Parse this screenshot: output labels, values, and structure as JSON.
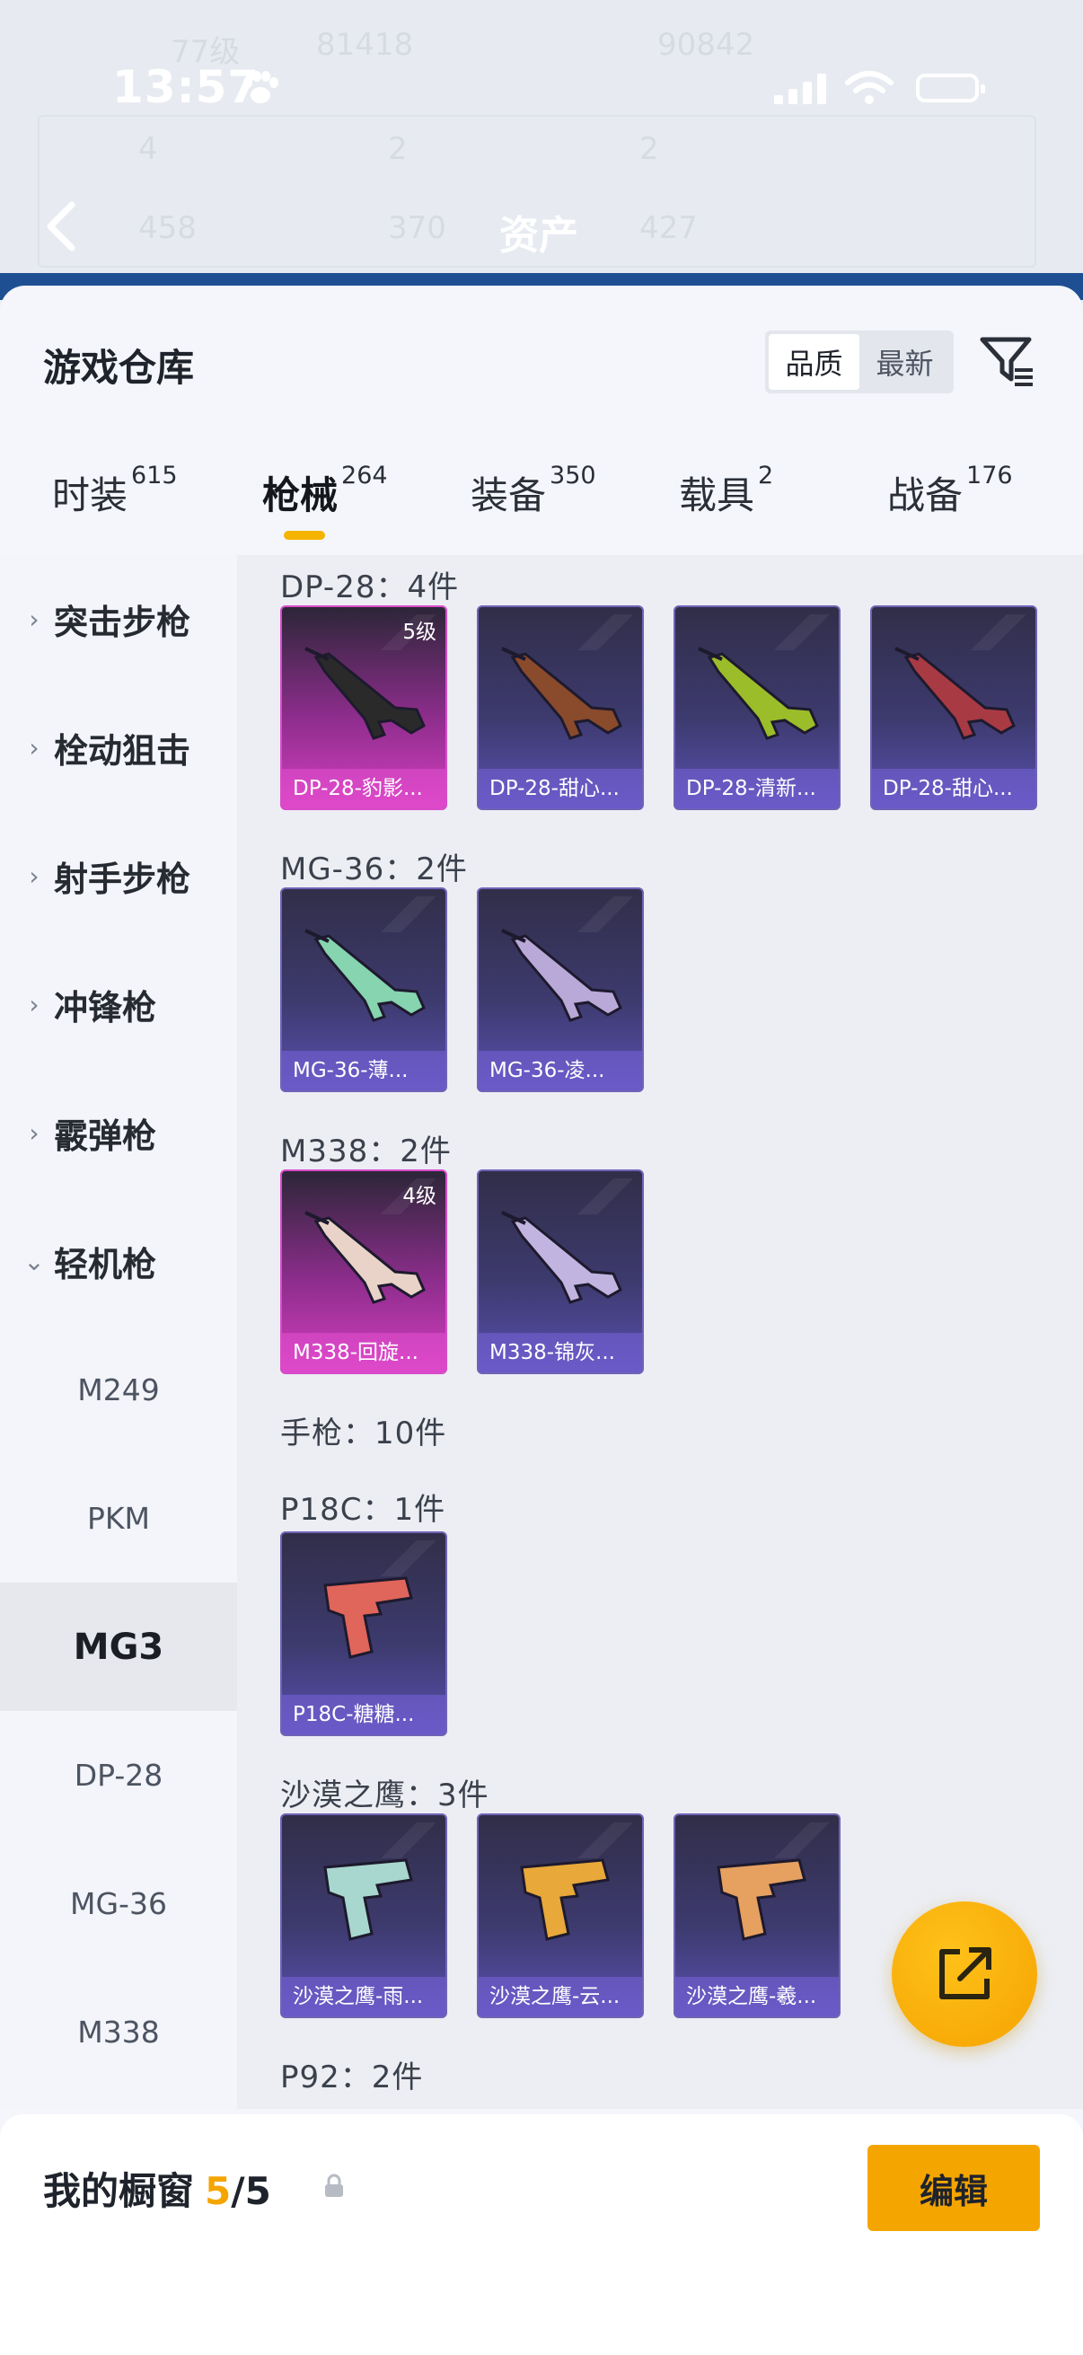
{
  "status_bar": {
    "time": "13:57"
  },
  "background_header": {
    "ghost_texts": [
      "77级",
      "81418",
      "90842"
    ],
    "ghost_stats": [
      "4",
      "2",
      "2",
      "458",
      "370",
      "427"
    ],
    "title": "资产"
  },
  "sheet": {
    "title": "游戏仓库",
    "sort_options": [
      "品质",
      "最新"
    ],
    "sort_active": "品质"
  },
  "tabs": [
    {
      "label": "时装",
      "count": "615"
    },
    {
      "label": "枪械",
      "count": "264"
    },
    {
      "label": "装备",
      "count": "350"
    },
    {
      "label": "载具",
      "count": "2"
    },
    {
      "label": "战备",
      "count": "176"
    }
  ],
  "sidebar": {
    "categories": [
      "突击步枪",
      "栓动狙击",
      "射手步枪",
      "冲锋枪",
      "霰弹枪",
      "轻机枪"
    ],
    "subitems": [
      "M249",
      "PKM",
      "MG3",
      "DP-28",
      "MG-36",
      "M338"
    ],
    "active_sub": "MG3"
  },
  "content": {
    "groups": [
      {
        "heading": "DP-28：4件",
        "items": [
          {
            "name": "DP-28-豹影...",
            "level": "5级",
            "rarity": "pink",
            "gun_color": "#2a2a2a"
          },
          {
            "name": "DP-28-甜心...",
            "level": "",
            "rarity": "blue",
            "gun_color": "#8a4a2c"
          },
          {
            "name": "DP-28-清新...",
            "level": "",
            "rarity": "blue",
            "gun_color": "#9bbd2a"
          },
          {
            "name": "DP-28-甜心...",
            "level": "",
            "rarity": "blue",
            "gun_color": "#a83a44"
          }
        ]
      },
      {
        "heading": "MG-36：2件",
        "items": [
          {
            "name": "MG-36-薄...",
            "level": "",
            "rarity": "blue",
            "gun_color": "#86d4b0"
          },
          {
            "name": "MG-36-凌...",
            "level": "",
            "rarity": "blue",
            "gun_color": "#b9a9d8"
          }
        ]
      },
      {
        "heading": "M338：2件",
        "items": [
          {
            "name": "M338-回旋...",
            "level": "4级",
            "rarity": "pink",
            "gun_color": "#e9d3c8"
          },
          {
            "name": "M338-锦灰...",
            "level": "",
            "rarity": "blue",
            "gun_color": "#c2b4e0"
          }
        ]
      },
      {
        "heading": "手枪：10件",
        "items": []
      },
      {
        "heading": "P18C：1件",
        "items": [
          {
            "name": "P18C-糖糖...",
            "level": "",
            "rarity": "blue",
            "gun_color": "#e0655a"
          }
        ]
      },
      {
        "heading": "沙漠之鹰：3件",
        "items": [
          {
            "name": "沙漠之鹰-雨...",
            "level": "",
            "rarity": "blue",
            "gun_color": "#a8d7cf"
          },
          {
            "name": "沙漠之鹰-云...",
            "level": "",
            "rarity": "blue",
            "gun_color": "#e8a83a"
          },
          {
            "name": "沙漠之鹰-羲...",
            "level": "",
            "rarity": "blue",
            "gun_color": "#e6a060"
          }
        ]
      },
      {
        "heading": "P92：2件",
        "items": []
      }
    ]
  },
  "bottom_bar": {
    "label": "我的橱窗",
    "current": "5",
    "separator": "/",
    "max": "5",
    "edit_label": "编辑"
  },
  "colors": {
    "accent": "#f5a500",
    "rarity_pink": "#d43fc0",
    "rarity_blue": "#5a4fb0"
  }
}
